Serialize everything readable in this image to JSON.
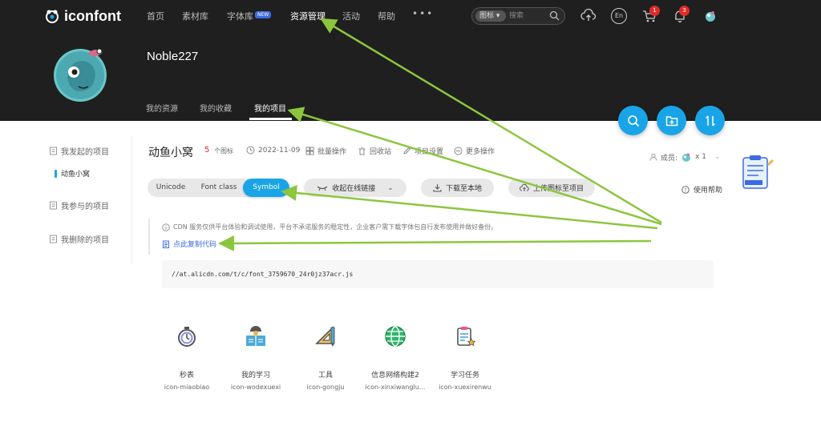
{
  "brand": {
    "name": "iconfont"
  },
  "nav": {
    "items": [
      "首页",
      "素材库",
      "字体库",
      "资源管理",
      "活动",
      "帮助"
    ],
    "new_badge": "NEW",
    "more": "•••"
  },
  "search": {
    "type": "图标",
    "placeholder": "搜索"
  },
  "top_icons": {
    "lang": "En",
    "cart_count": "1",
    "bell_count": "3"
  },
  "profile": {
    "username": "Noble227"
  },
  "subtabs": [
    "我的资源",
    "我的收藏",
    "我的项目"
  ],
  "sidebar": {
    "started": "我发起的项目",
    "project": "动鱼小窝",
    "joined": "我参与的项目",
    "deleted": "我删除的项目"
  },
  "project": {
    "title": "动鱼小窝",
    "count": "5",
    "count_unit": "个图标",
    "date": "2022-11-09",
    "batch": "批量操作",
    "recycle": "回收站",
    "settings": "项目设置",
    "more": "更多操作",
    "members_label": "成员:",
    "members_count": "x 1",
    "help": "使用帮助"
  },
  "tabs": {
    "unicode": "Unicode",
    "fontclass": "Font class",
    "symbol": "Symbol"
  },
  "buttons": {
    "collapse": "收起在线链接",
    "download": "下载至本地",
    "upload": "上传图标至项目"
  },
  "notice": {
    "text": "CDN 服务仅供平台体验和调试使用，平台不承诺服务的稳定性，企业客户需下载字体包自行发布使用并做好备份。",
    "copy": "点此复制代码",
    "code": "//at.alicdn.com/t/c/font_3759670_24r0jz37acr.js"
  },
  "icons": [
    {
      "cn": "秒表",
      "en": "icon-miaobiao"
    },
    {
      "cn": "我的学习",
      "en": "icon-wodexuexi"
    },
    {
      "cn": "工具",
      "en": "icon-gongju"
    },
    {
      "cn": "信息网络构建2",
      "en": "icon-xinxiwanglu..."
    },
    {
      "cn": "学习任务",
      "en": "icon-xuexirenwu"
    }
  ],
  "colors": {
    "accent": "#1aa4e8",
    "header": "#1f1f1f",
    "red": "#e02b2b",
    "link": "#3e6ae1",
    "arrow": "#8cc63f"
  }
}
